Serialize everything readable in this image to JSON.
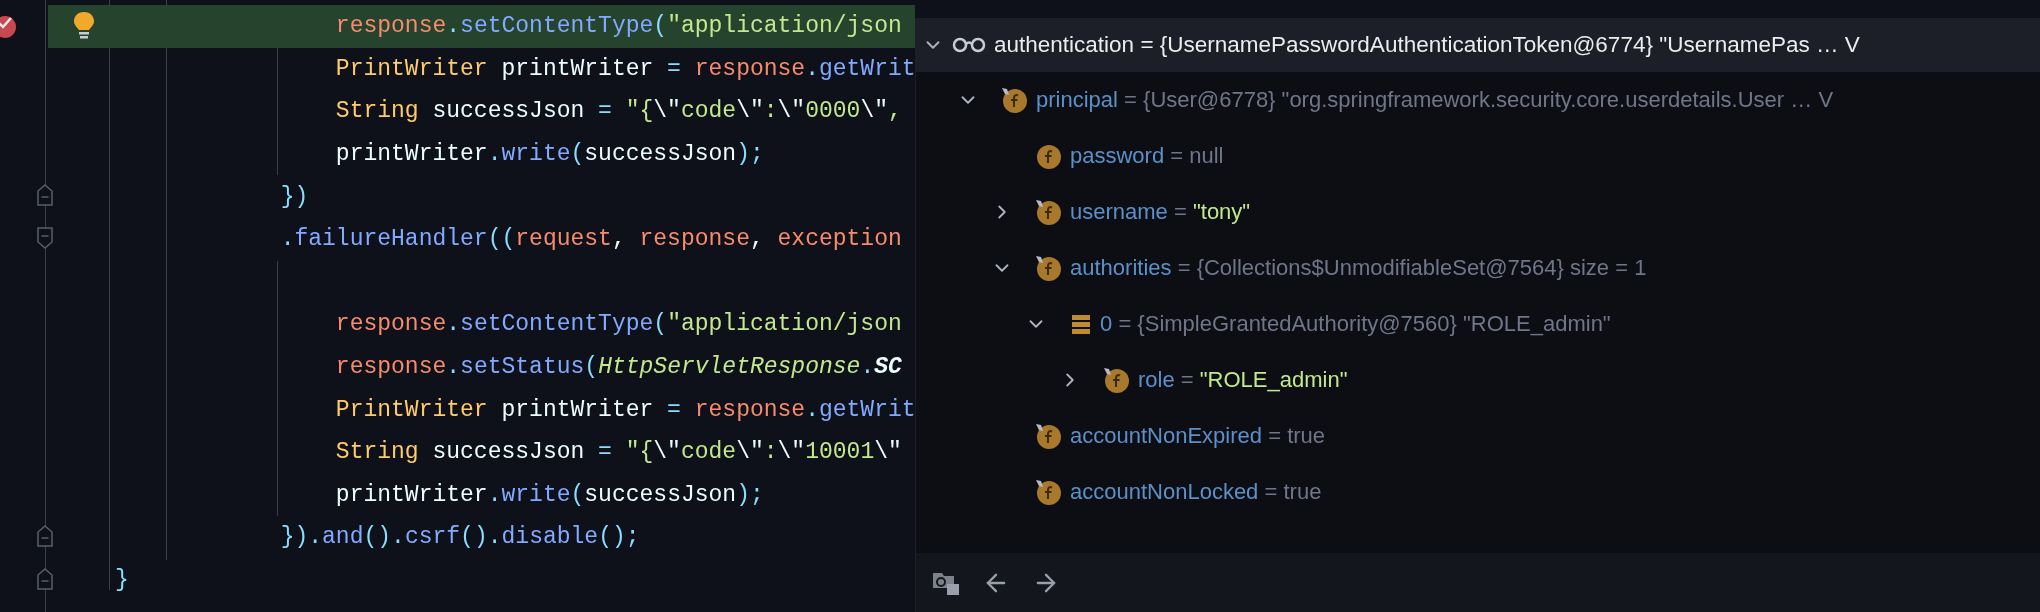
{
  "code": {
    "lines": [
      {
        "highlighted": true,
        "breakpoint": true,
        "bulb": true,
        "tokens": [
          {
            "kind": "var",
            "text": "                response"
          },
          {
            "kind": "punct",
            "text": "."
          },
          {
            "kind": "method",
            "text": "setContentType"
          },
          {
            "kind": "punct",
            "text": "("
          },
          {
            "kind": "string",
            "text": "\"application/json"
          }
        ]
      },
      {
        "tokens": [
          {
            "kind": "type",
            "text": "                PrintWriter"
          },
          {
            "kind": "ident",
            "text": " printWriter "
          },
          {
            "kind": "punct",
            "text": "= "
          },
          {
            "kind": "var",
            "text": "response"
          },
          {
            "kind": "punct",
            "text": "."
          },
          {
            "kind": "method",
            "text": "getWrit"
          }
        ]
      },
      {
        "tokens": [
          {
            "kind": "type",
            "text": "                String"
          },
          {
            "kind": "ident",
            "text": " successJson "
          },
          {
            "kind": "punct",
            "text": "= "
          },
          {
            "kind": "string",
            "text": "\"{"
          },
          {
            "kind": "escape",
            "text": "\\\""
          },
          {
            "kind": "string",
            "text": "code"
          },
          {
            "kind": "escape",
            "text": "\\\""
          },
          {
            "kind": "string",
            "text": ":"
          },
          {
            "kind": "escape",
            "text": "\\\""
          },
          {
            "kind": "string",
            "text": "0000"
          },
          {
            "kind": "escape",
            "text": "\\\""
          },
          {
            "kind": "string",
            "text": ","
          }
        ]
      },
      {
        "tokens": [
          {
            "kind": "ident",
            "text": "                printWriter"
          },
          {
            "kind": "punct",
            "text": "."
          },
          {
            "kind": "method",
            "text": "write"
          },
          {
            "kind": "punct",
            "text": "("
          },
          {
            "kind": "ident",
            "text": "successJson"
          },
          {
            "kind": "punct",
            "text": ");"
          }
        ]
      },
      {
        "fold_end": true,
        "tokens": [
          {
            "kind": "punct",
            "text": "            })"
          }
        ]
      },
      {
        "fold_start": true,
        "tokens": [
          {
            "kind": "punct",
            "text": "            ."
          },
          {
            "kind": "method",
            "text": "failureHandler"
          },
          {
            "kind": "punct",
            "text": "(("
          },
          {
            "kind": "var",
            "text": "request"
          },
          {
            "kind": "ident",
            "text": ", "
          },
          {
            "kind": "var",
            "text": "response"
          },
          {
            "kind": "ident",
            "text": ", "
          },
          {
            "kind": "var",
            "text": "exception"
          }
        ]
      },
      {
        "blank_line_before": true,
        "tokens": [
          {
            "kind": "var",
            "text": "                response"
          },
          {
            "kind": "punct",
            "text": "."
          },
          {
            "kind": "method",
            "text": "setContentType"
          },
          {
            "kind": "punct",
            "text": "("
          },
          {
            "kind": "string",
            "text": "\"application/json"
          }
        ]
      },
      {
        "tokens": [
          {
            "kind": "var",
            "text": "                response"
          },
          {
            "kind": "punct",
            "text": "."
          },
          {
            "kind": "method",
            "text": "setStatus"
          },
          {
            "kind": "punct",
            "text": "("
          },
          {
            "kind": "class",
            "text": "HttpServletResponse"
          },
          {
            "kind": "punct",
            "text": "."
          },
          {
            "kind": "constant",
            "text": "SC"
          }
        ]
      },
      {
        "tokens": [
          {
            "kind": "type",
            "text": "                PrintWriter"
          },
          {
            "kind": "ident",
            "text": " printWriter "
          },
          {
            "kind": "punct",
            "text": "= "
          },
          {
            "kind": "var",
            "text": "response"
          },
          {
            "kind": "punct",
            "text": "."
          },
          {
            "kind": "method",
            "text": "getWrit"
          }
        ]
      },
      {
        "tokens": [
          {
            "kind": "type",
            "text": "                String"
          },
          {
            "kind": "ident",
            "text": " successJson "
          },
          {
            "kind": "punct",
            "text": "= "
          },
          {
            "kind": "string",
            "text": "\"{"
          },
          {
            "kind": "escape",
            "text": "\\\""
          },
          {
            "kind": "string",
            "text": "code"
          },
          {
            "kind": "escape",
            "text": "\\\""
          },
          {
            "kind": "string",
            "text": ":"
          },
          {
            "kind": "escape",
            "text": "\\\""
          },
          {
            "kind": "string",
            "text": "10001"
          },
          {
            "kind": "escape",
            "text": "\\\""
          }
        ]
      },
      {
        "tokens": [
          {
            "kind": "ident",
            "text": "                printWriter"
          },
          {
            "kind": "punct",
            "text": "."
          },
          {
            "kind": "method",
            "text": "write"
          },
          {
            "kind": "punct",
            "text": "("
          },
          {
            "kind": "ident",
            "text": "successJson"
          },
          {
            "kind": "punct",
            "text": ");"
          }
        ]
      },
      {
        "fold_end": true,
        "tokens": [
          {
            "kind": "punct",
            "text": "            })."
          },
          {
            "kind": "method",
            "text": "and"
          },
          {
            "kind": "punct",
            "text": "()."
          },
          {
            "kind": "method",
            "text": "csrf"
          },
          {
            "kind": "punct",
            "text": "()."
          },
          {
            "kind": "method",
            "text": "disable"
          },
          {
            "kind": "punct",
            "text": "();"
          }
        ]
      },
      {
        "fold_end": true,
        "tokens": [
          {
            "kind": "punct",
            "text": "}"
          }
        ]
      }
    ]
  },
  "debugger": {
    "header": {
      "name": "authentication",
      "eq": "=",
      "value": "{UsernamePasswordAuthenticationToken@6774} \"UsernamePas … V",
      "expanded": true
    },
    "items": [
      {
        "kind": "final-field",
        "name": "principal",
        "eq": "=",
        "value": "{User@6778} \"org.springframework.security.core.userdetails.User … V",
        "expanded": true,
        "children": [
          {
            "kind": "field",
            "name": "password",
            "eq": "=",
            "value": "null"
          },
          {
            "kind": "final-field",
            "name": "username",
            "eq": "=",
            "value": "\"tony\"",
            "is_string": true,
            "expanded": false
          },
          {
            "kind": "final-field",
            "name": "authorities",
            "eq": "=",
            "value": "{Collections$UnmodifiableSet@7564}  size = 1",
            "expanded": true,
            "children": [
              {
                "kind": "array-item",
                "name": "0",
                "eq": "=",
                "value": "{SimpleGrantedAuthority@7560} \"ROLE_admin\"",
                "expanded": true,
                "children": [
                  {
                    "kind": "final-field",
                    "name": "role",
                    "eq": "=",
                    "value": "\"ROLE_admin\"",
                    "is_string": true,
                    "expanded": false
                  }
                ]
              }
            ]
          },
          {
            "kind": "final-field",
            "name": "accountNonExpired",
            "eq": "=",
            "value": "true"
          },
          {
            "kind": "final-field",
            "name": "accountNonLocked",
            "eq": "=",
            "value": "true"
          }
        ]
      }
    ]
  }
}
